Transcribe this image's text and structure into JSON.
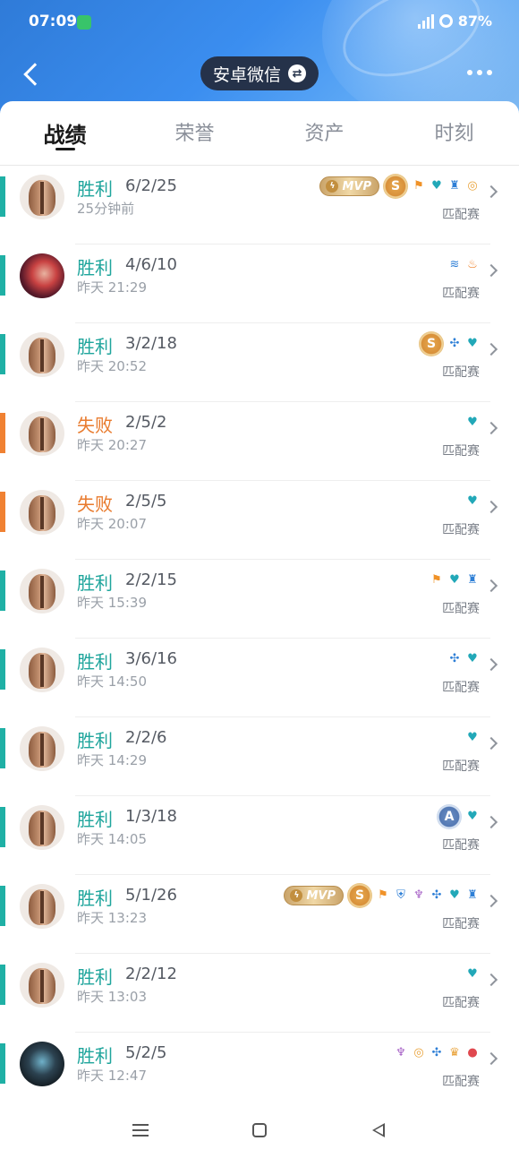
{
  "status_bar": {
    "time": "07:09",
    "battery": "87%"
  },
  "header": {
    "account_label": "安卓微信"
  },
  "tabs": [
    "战绩",
    "荣誉",
    "资产",
    "时刻"
  ],
  "colors": {
    "win": "#1fb0a5",
    "lose": "#f08132",
    "header": "#3b8ef0"
  },
  "matches": [
    {
      "result": "胜利",
      "kda": "6/2/25",
      "time": "25分钟前",
      "mode": "匹配赛",
      "avatar": "knight",
      "mvp": "MVP",
      "grade": "S",
      "icons": [
        "flag-icon",
        "heart-plus-icon",
        "tower-icon",
        "gold-icon"
      ]
    },
    {
      "result": "胜利",
      "kda": "4/6/10",
      "time": "昨天 21:29",
      "mode": "匹配赛",
      "avatar": "redhair",
      "icons": [
        "wave-icon",
        "fire-icon"
      ]
    },
    {
      "result": "胜利",
      "kda": "3/2/18",
      "time": "昨天 20:52",
      "mode": "匹配赛",
      "avatar": "knight",
      "grade": "S",
      "icons": [
        "assist-icon",
        "heart-plus-icon"
      ]
    },
    {
      "result": "失败",
      "kda": "2/5/2",
      "time": "昨天 20:27",
      "mode": "匹配赛",
      "avatar": "knight",
      "icons": [
        "heart-plus-icon"
      ]
    },
    {
      "result": "失败",
      "kda": "2/5/5",
      "time": "昨天 20:07",
      "mode": "匹配赛",
      "avatar": "knight",
      "icons": [
        "heart-plus-icon"
      ]
    },
    {
      "result": "胜利",
      "kda": "2/2/15",
      "time": "昨天 15:39",
      "mode": "匹配赛",
      "avatar": "knight",
      "icons": [
        "flag-icon",
        "heart-plus-icon",
        "tower-icon"
      ]
    },
    {
      "result": "胜利",
      "kda": "3/6/16",
      "time": "昨天 14:50",
      "mode": "匹配赛",
      "avatar": "knight",
      "icons": [
        "assist-icon",
        "heart-plus-icon"
      ]
    },
    {
      "result": "胜利",
      "kda": "2/2/6",
      "time": "昨天 14:29",
      "mode": "匹配赛",
      "avatar": "knight",
      "icons": [
        "heart-plus-icon"
      ]
    },
    {
      "result": "胜利",
      "kda": "1/3/18",
      "time": "昨天 14:05",
      "mode": "匹配赛",
      "avatar": "knight",
      "grade": "A",
      "icons": [
        "heart-plus-icon"
      ]
    },
    {
      "result": "胜利",
      "kda": "5/1/26",
      "time": "昨天 13:23",
      "mode": "匹配赛",
      "avatar": "knight",
      "mvp": "MVP",
      "grade": "S",
      "icons": [
        "flag-icon",
        "shield-icon",
        "demon-icon",
        "assist-icon",
        "heart-plus-icon",
        "tower-icon"
      ]
    },
    {
      "result": "胜利",
      "kda": "2/2/12",
      "time": "昨天 13:03",
      "mode": "匹配赛",
      "avatar": "knight",
      "icons": [
        "heart-plus-icon"
      ]
    },
    {
      "result": "胜利",
      "kda": "5/2/5",
      "time": "昨天 12:47",
      "mode": "匹配赛",
      "avatar": "robot",
      "icons": [
        "demon-icon",
        "gold-icon",
        "assist-icon",
        "cup-icon",
        "blood-icon"
      ]
    }
  ]
}
